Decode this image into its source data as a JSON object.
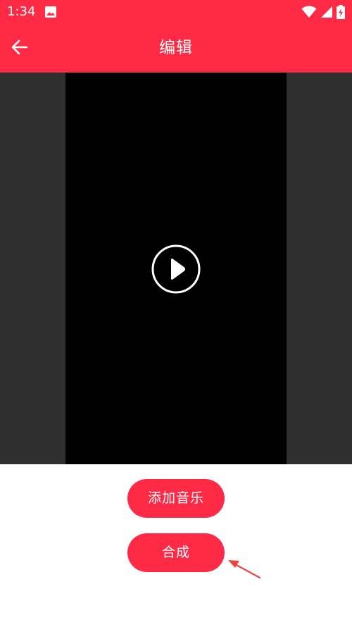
{
  "status_bar": {
    "time": "1:34",
    "icons": [
      "image-icon",
      "wifi-icon",
      "signal-icon",
      "battery-icon"
    ]
  },
  "toolbar": {
    "back_icon": "arrow-left-icon",
    "title": "编辑"
  },
  "video": {
    "play_icon": "play-circle-icon"
  },
  "actions": {
    "add_music_label": "添加音乐",
    "compose_label": "合成"
  },
  "colors": {
    "brand": "#ff2a45",
    "video_side": "#2f2f2f",
    "video_frame": "#000000",
    "annotation": "#e8473d"
  }
}
